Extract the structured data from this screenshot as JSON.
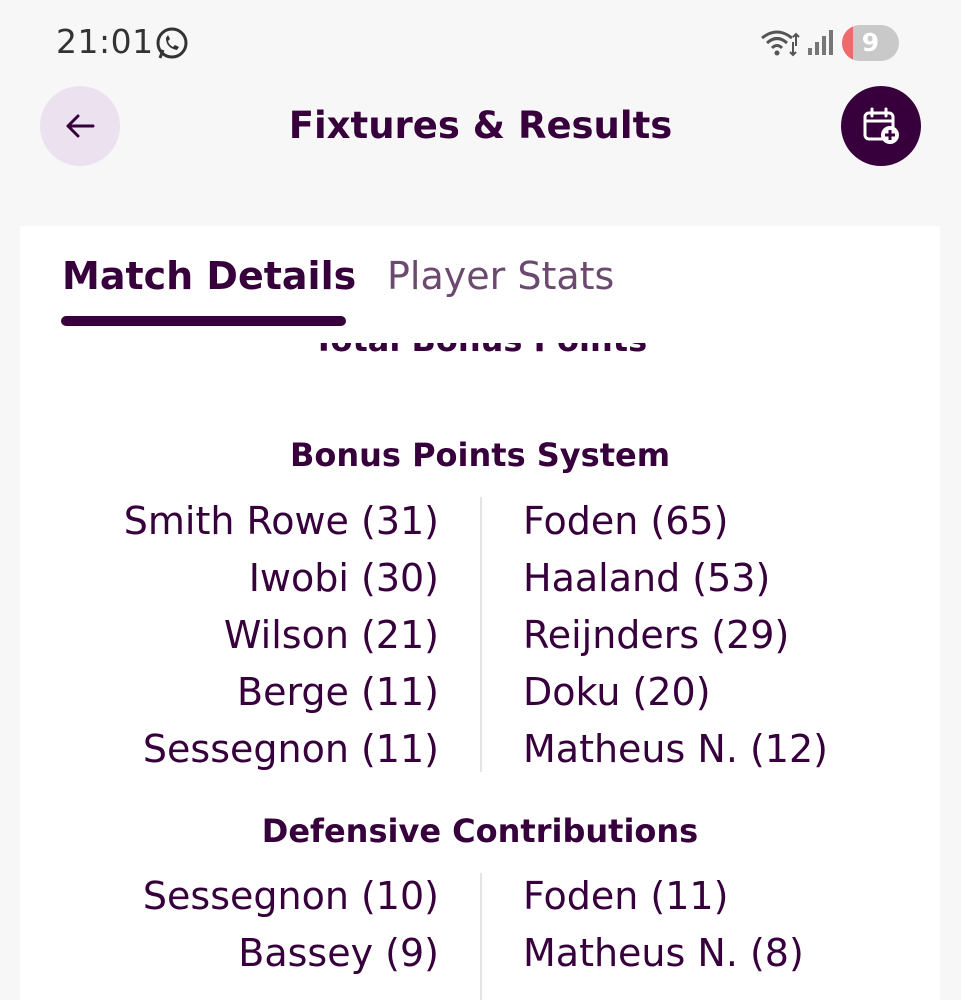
{
  "status_bar": {
    "time": "21:01",
    "battery": "9",
    "battery_level_percent": 9,
    "icons": [
      "whatsapp-icon",
      "wifi-icon",
      "signal-icon",
      "battery-icon"
    ]
  },
  "header": {
    "title": "Fixtures & Results",
    "back_icon": "arrow-left-icon",
    "action_icon": "calendar-add-icon"
  },
  "tabs": [
    {
      "label": "Match Details",
      "active": true
    },
    {
      "label": "Player Stats",
      "active": false
    }
  ],
  "cut_off_heading": "Total Bonus Points",
  "sections": [
    {
      "title": "Bonus Points System",
      "home": [
        "Smith Rowe (31)",
        "Iwobi (30)",
        "Wilson (21)",
        "Berge (11)",
        "Sessegnon (11)"
      ],
      "away": [
        "Foden (65)",
        "Haaland (53)",
        "Reijnders (29)",
        "Doku (20)",
        "Matheus N. (12)"
      ]
    },
    {
      "title": "Defensive Contributions",
      "home": [
        "Sessegnon (10)",
        "Bassey (9)"
      ],
      "away": [
        "Foden (11)",
        "Matheus N. (8)"
      ]
    }
  ],
  "colors": {
    "primary": "#37003c",
    "back_button_bg": "#ece1ee",
    "battery_low": "#ef6a6a"
  }
}
